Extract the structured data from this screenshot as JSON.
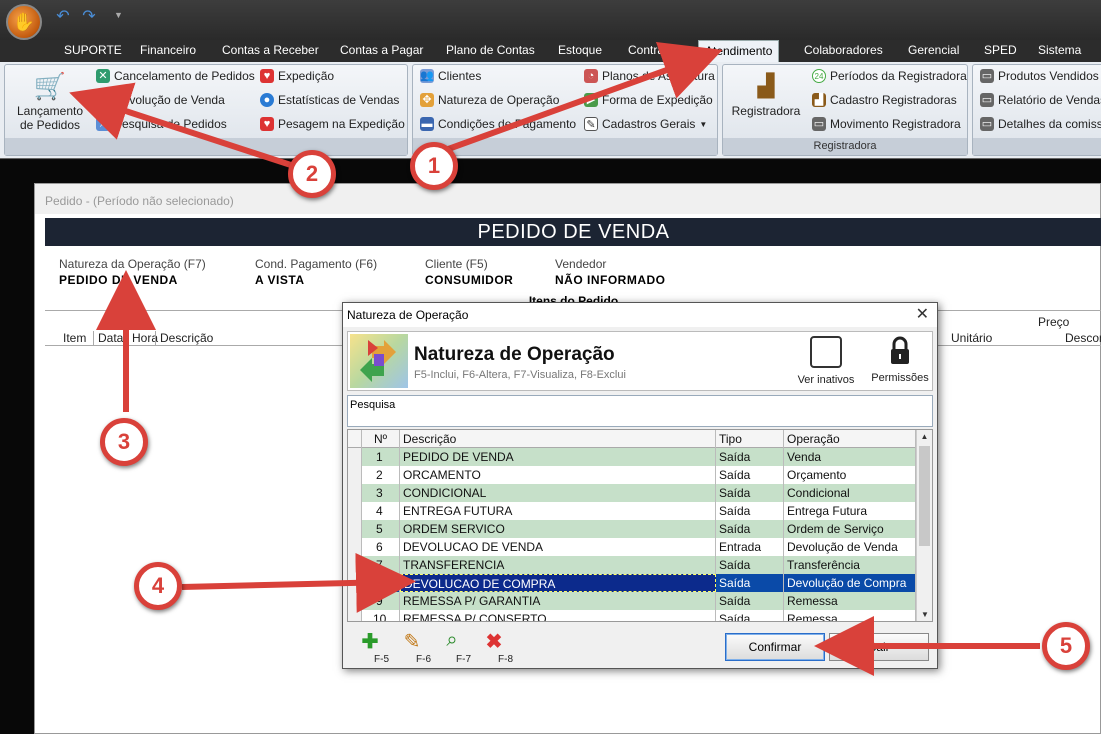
{
  "menu": {
    "tabs": [
      "SUPORTE",
      "Financeiro",
      "Contas a Receber",
      "Contas a Pagar",
      "Plano de Contas",
      "Estoque",
      "Contratos",
      "Atendimento",
      "Colaboradores",
      "Gerencial",
      "SPED",
      "Sistema"
    ],
    "active_tab": "Atendimento"
  },
  "ribbon": {
    "lancamento": "Lançamento de Pedidos",
    "col1": [
      "Cancelamento de Pedidos",
      "Devolução de Venda",
      "Pesquisa de Pedidos"
    ],
    "col2": [
      "Expedição",
      "Estatísticas de Vendas",
      "Pesagem na Expedição"
    ],
    "col3": [
      "Clientes",
      "Natureza de Operação",
      "Condições de Pagamento"
    ],
    "col4": [
      "Planos de Assinatura",
      "Forma de Expedição",
      "Cadastros Gerais"
    ],
    "registradora": "Registradora",
    "col5": [
      "Períodos da Registradora",
      "Cadastro Registradoras",
      "Movimento Registradora"
    ],
    "registradora_footer": "Registradora",
    "col6": [
      "Produtos Vendidos",
      "Relatório de Vendas",
      "Detalhes da comiss"
    ]
  },
  "pedido": {
    "window_title": "Pedido - (Período não selecionado)",
    "header": "PEDIDO DE VENDA",
    "fields": [
      {
        "label": "Natureza da Operação (F7)",
        "value": "PEDIDO DE VENDA"
      },
      {
        "label": "Cond. Pagamento (F6)",
        "value": "A VISTA"
      },
      {
        "label": "Cliente (F5)",
        "value": "CONSUMIDOR"
      },
      {
        "label": "Vendedor",
        "value": "NÃO INFORMADO"
      }
    ],
    "itens_title": "Itens do Pedido",
    "columns": [
      "Item",
      "Data",
      "Hora",
      "Descrição"
    ],
    "preco": "Preço",
    "unitario": "Unitário",
    "desconto": "Descon"
  },
  "dialog": {
    "title": "Natureza de Operação",
    "heading": "Natureza de Operação",
    "shortcuts": "F5-Inclui, F6-Altera, F7-Visualiza, F8-Exclui",
    "ver_inativos": "Ver inativos",
    "permissoes": "Permissões",
    "pesquisa": "Pesquisa",
    "columns": [
      "Nº",
      "Descrição",
      "Tipo",
      "Operação"
    ],
    "rows": [
      {
        "n": "1",
        "desc": "PEDIDO DE VENDA",
        "tipo": "Saída",
        "op": "Venda"
      },
      {
        "n": "2",
        "desc": "ORCAMENTO",
        "tipo": "Saída",
        "op": "Orçamento"
      },
      {
        "n": "3",
        "desc": "CONDICIONAL",
        "tipo": "Saída",
        "op": "Condicional"
      },
      {
        "n": "4",
        "desc": "ENTREGA FUTURA",
        "tipo": "Saída",
        "op": "Entrega Futura"
      },
      {
        "n": "5",
        "desc": "ORDEM SERVICO",
        "tipo": "Saída",
        "op": "Ordem de Serviço"
      },
      {
        "n": "6",
        "desc": "DEVOLUCAO DE VENDA",
        "tipo": "Entrada",
        "op": "Devolução de Venda"
      },
      {
        "n": "7",
        "desc": "TRANSFERENCIA",
        "tipo": "Saída",
        "op": "Transferência"
      },
      {
        "n": "8",
        "desc": "DEVOLUCAO DE COMPRA",
        "tipo": "Saída",
        "op": "Devolução de Compra"
      },
      {
        "n": "9",
        "desc": "REMESSA P/ GARANTIA",
        "tipo": "Saída",
        "op": "Remessa"
      },
      {
        "n": "10",
        "desc": "REMESSA P/ CONSERTO",
        "tipo": "Saída",
        "op": "Remessa"
      }
    ],
    "tools": [
      "F-5",
      "F-6",
      "F-7",
      "F-8"
    ],
    "confirmar": "Confirmar",
    "sair": "Sair"
  },
  "callouts": [
    "1",
    "2",
    "3",
    "4",
    "5"
  ],
  "colors": {
    "accent_red": "#d9413a",
    "selection": "#0a4aa8",
    "row_green": "#c6e0c9"
  }
}
